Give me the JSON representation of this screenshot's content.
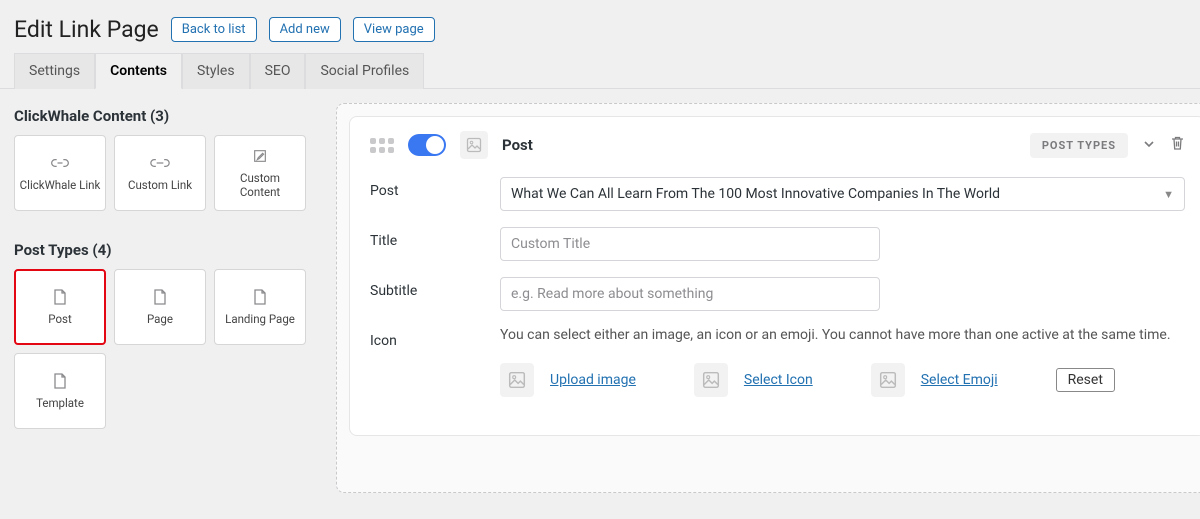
{
  "page": {
    "title": "Edit Link Page"
  },
  "actions": {
    "back": "Back to list",
    "add": "Add new",
    "view": "View page"
  },
  "tabs": {
    "settings": "Settings",
    "contents": "Contents",
    "styles": "Styles",
    "seo": "SEO",
    "social": "Social Profiles",
    "active": "contents"
  },
  "sidebar": {
    "group1": {
      "title": "ClickWhale Content (3)",
      "items": [
        {
          "key": "clickwhale-link",
          "label": "ClickWhale Link"
        },
        {
          "key": "custom-link",
          "label": "Custom Link"
        },
        {
          "key": "custom-content",
          "label": "Custom Content"
        }
      ]
    },
    "group2": {
      "title": "Post Types (4)",
      "items": [
        {
          "key": "post",
          "label": "Post",
          "highlight": true
        },
        {
          "key": "page",
          "label": "Page"
        },
        {
          "key": "landing-page",
          "label": "Landing Page"
        },
        {
          "key": "template",
          "label": "Template"
        }
      ]
    }
  },
  "panel": {
    "title": "Post",
    "pill": "POST TYPES",
    "fields": {
      "post_label": "Post",
      "post_value": "What We Can All Learn From The 100 Most Innovative Companies In The World",
      "title_label": "Title",
      "title_placeholder": "Custom Title",
      "title_value": "",
      "subtitle_label": "Subtitle",
      "subtitle_placeholder": "e.g. Read more about something",
      "subtitle_value": "",
      "icon_label": "Icon",
      "icon_desc": "You can select either an image, an icon or an emoji. You cannot have more than one active at the same time.",
      "upload_image": "Upload image",
      "select_icon": "Select Icon",
      "select_emoji": "Select Emoji",
      "reset": "Reset"
    }
  }
}
